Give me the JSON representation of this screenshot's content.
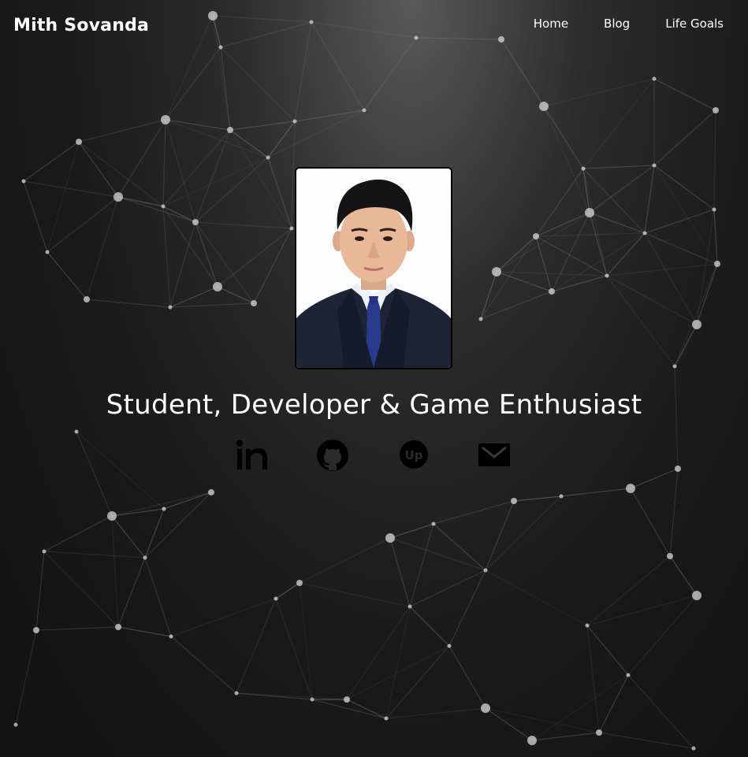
{
  "header": {
    "brand": "Mith Sovanda",
    "nav": [
      {
        "label": "Home"
      },
      {
        "label": "Blog"
      },
      {
        "label": "Life Goals"
      }
    ]
  },
  "hero": {
    "tagline": "Student, Developer & Game Enthusiast"
  },
  "socials": [
    {
      "icon": "linkedin-icon"
    },
    {
      "icon": "github-icon"
    },
    {
      "icon": "upwork-icon"
    },
    {
      "icon": "email-icon"
    }
  ],
  "colors": {
    "background": "#121212",
    "text": "#ffffff",
    "icon": "#000000"
  }
}
